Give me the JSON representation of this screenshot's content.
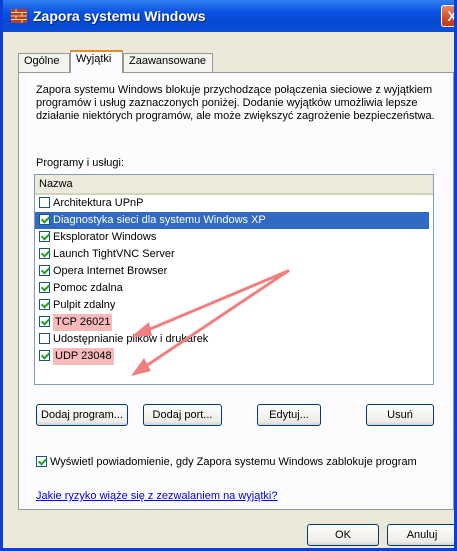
{
  "window": {
    "title": "Zapora systemu Windows",
    "close_glyph": "X"
  },
  "tabs": [
    {
      "label": "Ogólne",
      "active": false
    },
    {
      "label": "Wyjątki",
      "active": true
    },
    {
      "label": "Zaawansowane",
      "active": false
    }
  ],
  "description": "Zapora systemu Windows blokuje przychodzące połączenia sieciowe z wyjątkiem programów i usług zaznaczonych poniżej. Dodanie wyjątków umożliwia lepsze działanie niektórych programów, ale może zwiększyć zagrożenie bezpieczeństwa.",
  "programs_label": "Programy i usługi:",
  "list": {
    "column_header": "Nazwa",
    "items": [
      {
        "label": "Architektura UPnP",
        "checked": false,
        "selected": false,
        "highlighted": false
      },
      {
        "label": "Diagnostyka sieci dla systemu Windows XP",
        "checked": true,
        "selected": true,
        "highlighted": false
      },
      {
        "label": "Eksplorator Windows",
        "checked": true,
        "selected": false,
        "highlighted": false
      },
      {
        "label": "Launch TightVNC Server",
        "checked": true,
        "selected": false,
        "highlighted": false
      },
      {
        "label": "Opera Internet Browser",
        "checked": true,
        "selected": false,
        "highlighted": false
      },
      {
        "label": "Pomoc zdalna",
        "checked": true,
        "selected": false,
        "highlighted": false
      },
      {
        "label": "Pulpit zdalny",
        "checked": true,
        "selected": false,
        "highlighted": false
      },
      {
        "label": "TCP 26021",
        "checked": true,
        "selected": false,
        "highlighted": true
      },
      {
        "label": "Udostępnianie plików i drukarek",
        "checked": false,
        "selected": false,
        "highlighted": false
      },
      {
        "label": "UDP 23048",
        "checked": true,
        "selected": false,
        "highlighted": true
      }
    ]
  },
  "buttons": {
    "add_program": "Dodaj program...",
    "add_port": "Dodaj port...",
    "edit": "Edytuj...",
    "delete": "Usuń",
    "ok": "OK",
    "cancel": "Anuluj"
  },
  "notify": {
    "label": "Wyświetl powiadomienie, gdy Zapora systemu Windows zablokuje program",
    "checked": true
  },
  "risk_link": "Jakie ryzyko wiąże się z zezwalaniem na wyjątki?",
  "colors": {
    "title_bar": "#0a50e0",
    "selection": "#316ac5",
    "annotation_arrow": "#f08080",
    "highlight": "#f7b9b9"
  }
}
